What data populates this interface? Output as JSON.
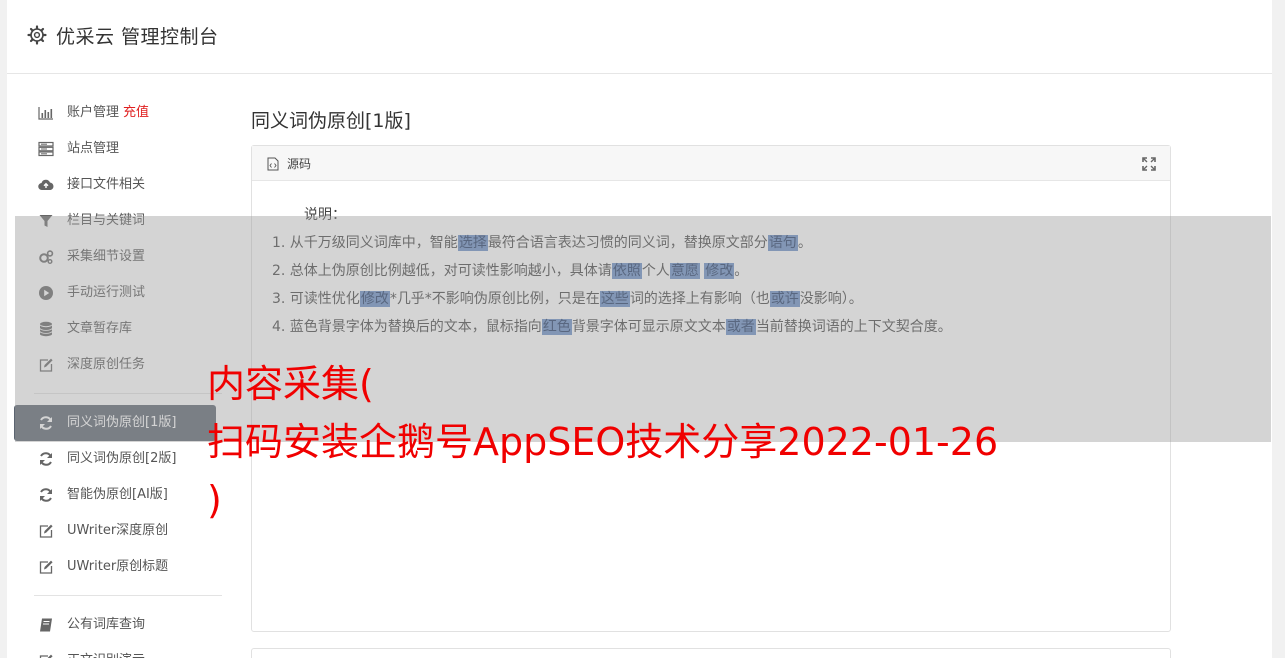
{
  "header": {
    "title": "优采云 管理控制台"
  },
  "sidebar": {
    "group1": [
      {
        "label": "账户管理",
        "extra": "充值",
        "icon": "bar-chart-icon"
      },
      {
        "label": "站点管理",
        "icon": "server-icon"
      },
      {
        "label": "接口文件相关",
        "icon": "cloud-upload-icon"
      },
      {
        "label": "栏目与关键词",
        "icon": "filter-icon"
      },
      {
        "label": "采集细节设置",
        "icon": "gears-icon"
      },
      {
        "label": "手动运行测试",
        "icon": "play-icon"
      },
      {
        "label": "文章暂存库",
        "icon": "database-icon"
      },
      {
        "label": "深度原创任务",
        "icon": "edit-icon"
      }
    ],
    "group2": [
      {
        "label": "同义词伪原创[1版]",
        "icon": "refresh-icon",
        "active": true
      },
      {
        "label": "同义词伪原创[2版]",
        "icon": "refresh-icon"
      },
      {
        "label": "智能伪原创[AI版]",
        "icon": "refresh-icon"
      },
      {
        "label": "UWriter深度原创",
        "icon": "edit-icon"
      },
      {
        "label": "UWriter原创标题",
        "icon": "edit-icon"
      }
    ],
    "group3": [
      {
        "label": "公有词库查询",
        "icon": "book-icon"
      },
      {
        "label": "正文识别演示",
        "icon": "edit-icon"
      }
    ]
  },
  "main": {
    "page_title": "同义词伪原创[1版]",
    "panel": {
      "title": "源码",
      "note_head": "说明：",
      "lines": [
        {
          "pre": "1. 从千万级同义词库中，智能",
          "h1": "选择",
          "mid": "最符合语言表达习惯的同义词，替换原文部分",
          "h2": "语句",
          "post": "。"
        },
        {
          "pre": "2. 总体上伪原创比例越低，对可读性影响越小，具体请",
          "h1": "依照",
          "mid": "个人",
          "h2": "意愿",
          "mid2": " ",
          "h3": "修改",
          "post": "。"
        },
        {
          "pre": "3. 可读性优化",
          "h1": "修改",
          "mid": "*几乎*不影响伪原创比例，只是在",
          "h2": "这些",
          "mid2": "词的选择上有影响（也",
          "h3": "或许",
          "post": "没影响）。"
        },
        {
          "pre": "4. 蓝色背景字体为替换后的文本，鼠标指向",
          "h1": "红色",
          "mid": "背景字体可显示原文文本",
          "h2": "或者",
          "post": "当前替换词语的上下文契合度。"
        }
      ]
    }
  },
  "overlay": {
    "line1": "内容采集(",
    "line2": "扫码安装企鹅号AppSEO技术分享2022-01-26",
    "line3": ")"
  }
}
